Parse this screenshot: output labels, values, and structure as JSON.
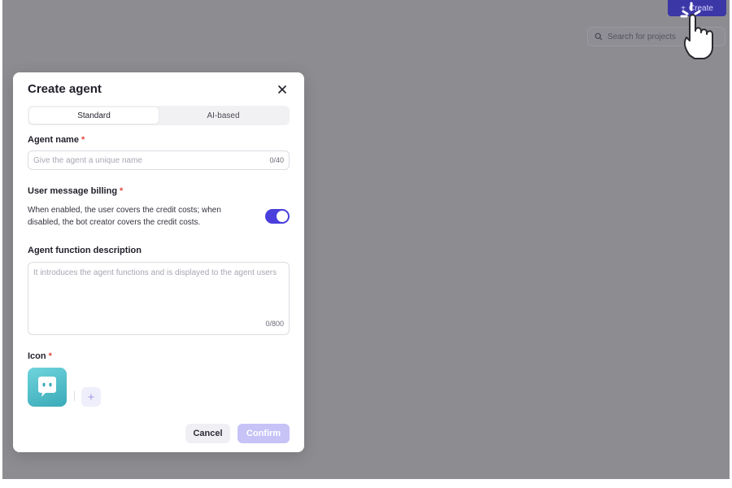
{
  "topbar": {
    "create_label": "Create",
    "search_placeholder": "Search for projects"
  },
  "modal": {
    "title": "Create agent",
    "tabs": [
      {
        "label": "Standard",
        "active": true
      },
      {
        "label": "AI-based",
        "active": false
      }
    ],
    "agent_name": {
      "label": "Agent name",
      "required_mark": "*",
      "placeholder": "Give the agent a unique name",
      "counter": "0/40"
    },
    "billing": {
      "label": "User message billing",
      "required_mark": "*",
      "description": "When enabled, the user covers the credit costs; when disabled, the bot creator covers the credit costs.",
      "enabled": true
    },
    "description": {
      "label": "Agent function description",
      "placeholder": "It introduces the agent functions and is displayed to the agent users",
      "counter": "0/800"
    },
    "icon": {
      "label": "Icon",
      "required_mark": "*",
      "current_icon": "chat-bot-icon",
      "generate_icon": "sparkle-icon"
    },
    "buttons": {
      "cancel": "Cancel",
      "confirm": "Confirm"
    }
  },
  "colors": {
    "overlay": "#8d8c91",
    "accent": "#4a3fdc",
    "confirm_disabled": "#c7c3f7",
    "required": "#e0493f",
    "icon_tile": "#4bbfca"
  }
}
